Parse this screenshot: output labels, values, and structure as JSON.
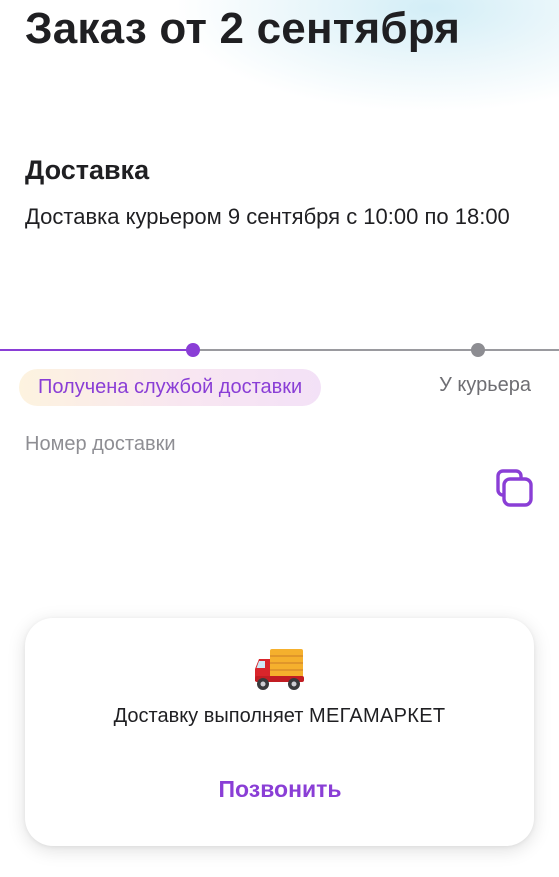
{
  "header": {
    "title": "Заказ от 2 сентября"
  },
  "delivery": {
    "section_title": "Доставка",
    "description": "Доставка курьером 9 сентября с 10:00 по 18:00"
  },
  "tracking": {
    "current_status": "Получена службой доставки",
    "next_status": "У курьера",
    "number_label": "Номер доставки",
    "accent_color": "#8a3ed6"
  },
  "carrier_card": {
    "icon": "delivery-truck-icon",
    "text_prefix": "Доставку выполняет",
    "carrier_name": "МЕГАМАРКЕТ",
    "call_label": "Позвонить"
  }
}
